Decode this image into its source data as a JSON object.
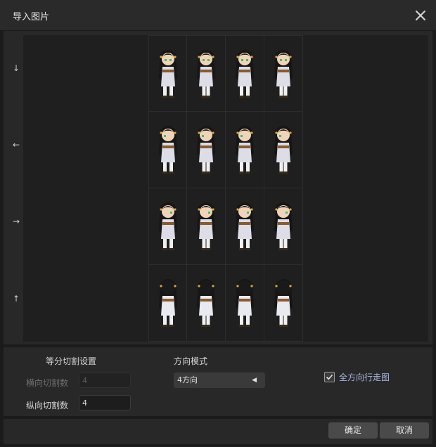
{
  "window": {
    "title": "导入图片",
    "close_icon": "close-icon"
  },
  "preview": {
    "direction_arrows": [
      "↓",
      "←",
      "→",
      "↑"
    ],
    "sprite_rows": [
      "down",
      "left",
      "right",
      "up"
    ],
    "sprite_cols": 4
  },
  "settings": {
    "split_title": "等分切割设置",
    "horizontal_label": "横向切割数",
    "horizontal_value": "4",
    "vertical_label": "纵向切割数",
    "vertical_value": "4",
    "direction_title": "方向模式",
    "direction_value": "4方向",
    "checkbox_label": "全方向行走图",
    "checkbox_checked": true
  },
  "footer": {
    "ok_label": "确定",
    "cancel_label": "取消"
  },
  "colors": {
    "accent_text": "#a9b7e6",
    "panel": "#282828",
    "canvas": "#1f1f1f"
  }
}
